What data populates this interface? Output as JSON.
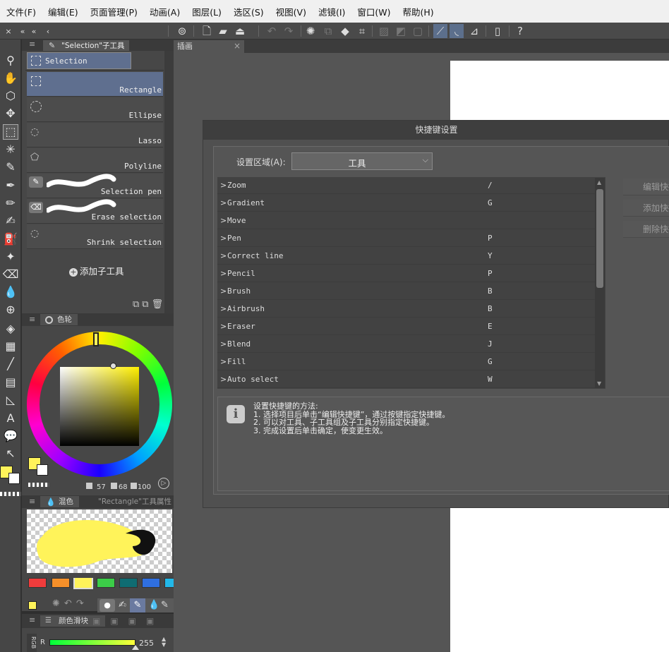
{
  "menu": [
    "文件(F)",
    "编辑(E)",
    "页面管理(P)",
    "动画(A)",
    "图层(L)",
    "选区(S)",
    "视图(V)",
    "滤镜(I)",
    "窗口(W)",
    "帮助(H)"
  ],
  "sub_tool_tab": "\"Selection\"子工具",
  "sub_tool_group": "Selection",
  "sub_tools": [
    "Rectangle",
    "Ellipse",
    "Lasso",
    "Polyline",
    "Selection pen",
    "Erase selection",
    "Shrink selection"
  ],
  "add_sub_tool": "添加子工具",
  "canvas_tab": "插画",
  "color_panel": {
    "tab": "色轮",
    "value_a": "57",
    "value_b": "68",
    "value_c": "100",
    "main_color": "#fff35a"
  },
  "mix_panel": {
    "tab": "混色",
    "tab2": "\"Rectangle\"工具属性"
  },
  "palette_colors": [
    "#f03c3c",
    "#f6902a",
    "#fff35a",
    "#3ccc48",
    "#0f6c72",
    "#2f6fe0",
    "#22b8e8"
  ],
  "slider_panel": {
    "tab": "颜色滑块",
    "mode": "RGB",
    "channel": "R",
    "value": "255"
  },
  "dialog": {
    "title": "快捷键设置",
    "area_label": "设置区域(A):",
    "area_value": "工具",
    "rows": [
      {
        "name": "Zoom",
        "key": "/"
      },
      {
        "name": "Gradient",
        "key": "G"
      },
      {
        "name": "Move",
        "key": ""
      },
      {
        "name": "Pen",
        "key": "P"
      },
      {
        "name": "Correct line",
        "key": "Y"
      },
      {
        "name": "Pencil",
        "key": "P"
      },
      {
        "name": "Brush",
        "key": "B"
      },
      {
        "name": "Airbrush",
        "key": "B"
      },
      {
        "name": "Eraser",
        "key": "E"
      },
      {
        "name": "Blend",
        "key": "J"
      },
      {
        "name": "Fill",
        "key": "G"
      },
      {
        "name": "Auto select",
        "key": "W"
      }
    ],
    "buttons": [
      "编辑快捷键",
      "添加快捷键",
      "删除快捷键"
    ],
    "help_title": "设置快捷键的方法:",
    "help_lines": [
      "1. 选择项目后单击“编辑快捷键”，通过按键指定快捷键。",
      "2. 可以对工具、子工具组及子工具分别指定快捷键。",
      "3. 完成设置后单击确定，使变更生效。"
    ]
  }
}
